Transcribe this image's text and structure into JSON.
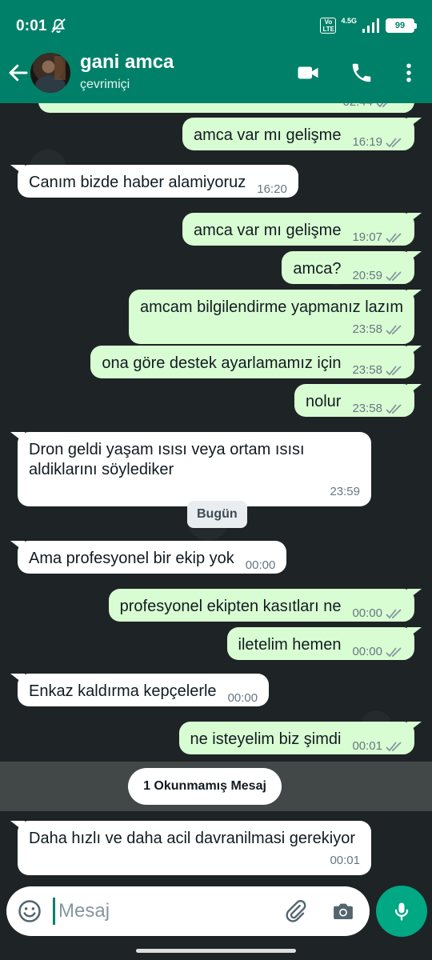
{
  "status_bar": {
    "time": "0:01",
    "network": "4.5G",
    "volte_top": "Vo",
    "volte_bottom": "LTE",
    "battery": "99"
  },
  "header": {
    "contact_name": "gani amca",
    "contact_status": "çevrimiçi"
  },
  "messages": [
    {
      "dir": "out",
      "text": "",
      "time": "02:44",
      "partial": true
    },
    {
      "dir": "out",
      "text": "amca var mı gelişme",
      "time": "16:19"
    },
    {
      "dir": "in",
      "text": "Canım bizde haber alamiyoruz",
      "time": "16:20"
    },
    {
      "dir": "out",
      "text": "amca var mı gelişme",
      "time": "19:07"
    },
    {
      "dir": "out",
      "text": "amca?",
      "time": "20:59"
    },
    {
      "dir": "out",
      "text": "amcam bilgilendirme yapmanız lazım",
      "time": "23:58"
    },
    {
      "dir": "out",
      "text": "ona göre destek ayarlamamız için",
      "time": "23:58"
    },
    {
      "dir": "out",
      "text": "nolur",
      "time": "23:58"
    },
    {
      "dir": "in",
      "text": "Dron geldi yaşam ısısı veya ortam ısısı aldiklarını söylediker",
      "time": "23:59"
    },
    {
      "dir": "in",
      "text": "Ama profesyonel bir ekip yok",
      "time": "00:00"
    },
    {
      "dir": "out",
      "text": "profesyonel ekipten kasıtları ne",
      "time": "00:00"
    },
    {
      "dir": "out",
      "text": "iletelim hemen",
      "time": "00:00"
    },
    {
      "dir": "in",
      "text": "Enkaz kaldırma kepçelerle",
      "time": "00:00"
    },
    {
      "dir": "out",
      "text": "ne isteyelim biz şimdi",
      "time": "00:01"
    },
    {
      "dir": "in",
      "text": "Daha hızlı ve daha acil davranilmasi gerekiyor",
      "time": "00:01"
    }
  ],
  "date_chip": "Bugün",
  "unread_banner": "1 Okunmamış Mesaj",
  "composer": {
    "placeholder": "Mesaj"
  },
  "colors": {
    "header": "#008069",
    "outgoing_bubble": "#d9fdd3",
    "incoming_bubble": "#ffffff",
    "chat_background": "#1e2426",
    "read_ticks": "#8696a0",
    "mic_button": "#00a884"
  },
  "icons": [
    "back-arrow-icon",
    "video-call-icon",
    "phone-call-icon",
    "more-vert-icon",
    "emoji-icon",
    "attach-icon",
    "camera-icon",
    "mic-icon",
    "mute-icon"
  ]
}
